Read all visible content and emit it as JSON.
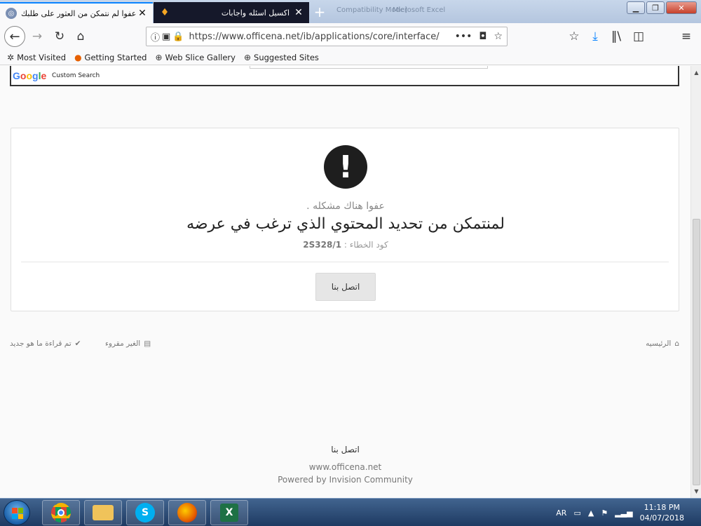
{
  "browser": {
    "tabs": [
      {
        "title": "عفوا لم نتمكن من العثور على طلبك",
        "active": true
      },
      {
        "title": "اكسيل اسئله واجابات",
        "active": false
      }
    ],
    "ghost_titles": [
      "Compatibility Mode]",
      "Microsoft Excel"
    ],
    "url": "https://www.officena.net/ib/applications/core/interface/",
    "bookmarks": [
      {
        "label": "Most Visited",
        "icon": "gear-icon"
      },
      {
        "label": "Getting Started",
        "icon": "firefox-icon"
      },
      {
        "label": "Web Slice Gallery",
        "icon": "globe-icon"
      },
      {
        "label": "Suggested Sites",
        "icon": "globe-icon"
      }
    ]
  },
  "search": {
    "brand": "Google",
    "label": "Custom Search"
  },
  "error": {
    "icon": "exclamation-icon",
    "subtitle": "عفوا هناك مشكله .",
    "title": "لمنتمكن من تحديد المحتوي الذي ترغب في عرضه",
    "code_label": "كود الخطاء :",
    "code_value": "2S328/1",
    "button": "اتصل بنا"
  },
  "footer_links": {
    "home": "الرئيسيه",
    "unread": "الغير مقروء",
    "mark_read": "تم قراءة ما هو جديد"
  },
  "footer": {
    "contact": "اتصل بنا",
    "domain": "www.officena.net",
    "powered": "Powered by Invision Community"
  },
  "taskbar": {
    "apps": [
      "chrome-icon",
      "file-explorer-icon",
      "skype-icon",
      "firefox-icon",
      "excel-icon"
    ],
    "lang": "AR",
    "time": "11:18 PM",
    "date": "04/07/2018"
  },
  "colors": {
    "accent": "#0a84ff",
    "download": "#0a84ff"
  }
}
